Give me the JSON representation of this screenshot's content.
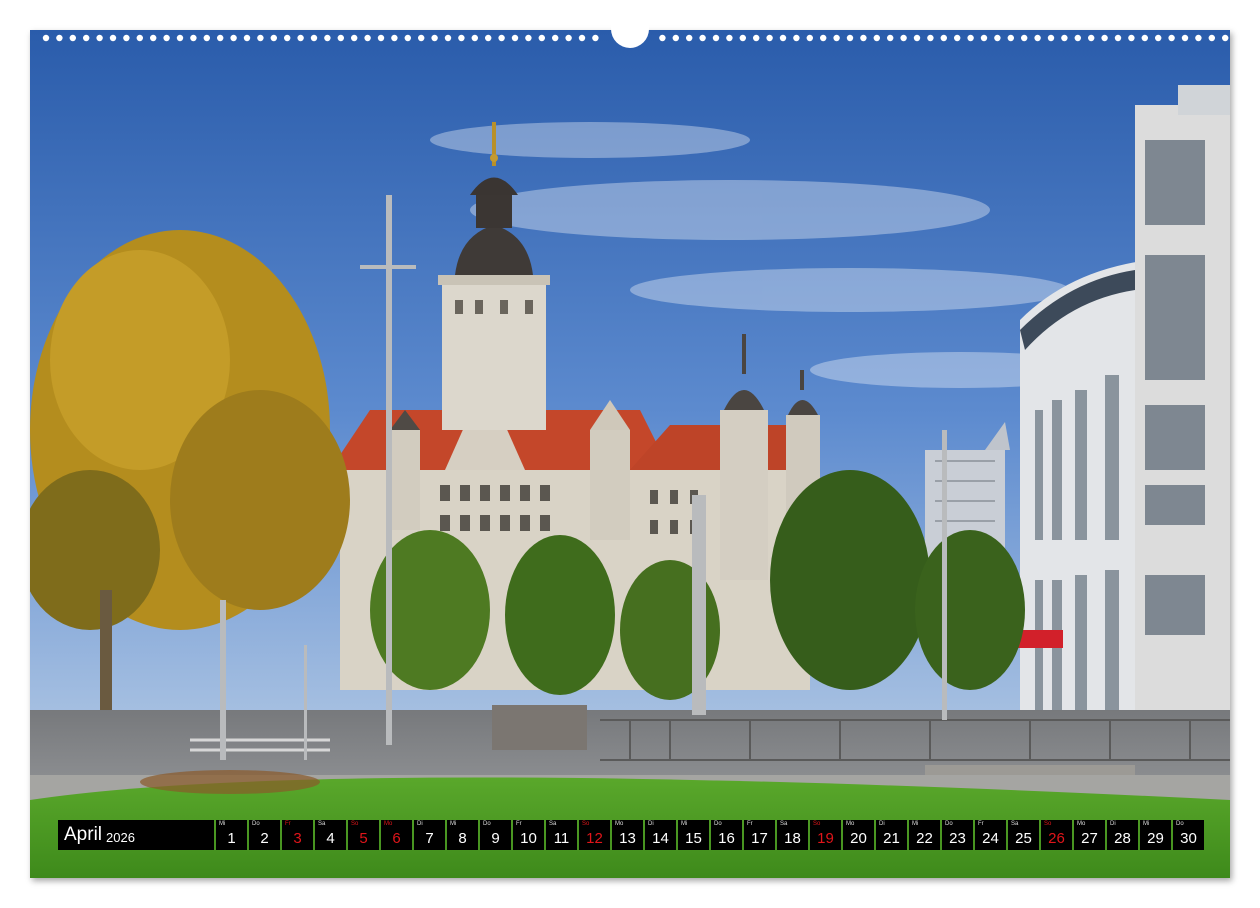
{
  "calendar": {
    "month": "April",
    "year": "2026",
    "days": [
      {
        "wd": "Mi",
        "d": "1",
        "red": false
      },
      {
        "wd": "Do",
        "d": "2",
        "red": false
      },
      {
        "wd": "Fr",
        "d": "3",
        "red": true
      },
      {
        "wd": "Sa",
        "d": "4",
        "red": false
      },
      {
        "wd": "So",
        "d": "5",
        "red": true
      },
      {
        "wd": "Mo",
        "d": "6",
        "red": true
      },
      {
        "wd": "Di",
        "d": "7",
        "red": false
      },
      {
        "wd": "Mi",
        "d": "8",
        "red": false
      },
      {
        "wd": "Do",
        "d": "9",
        "red": false
      },
      {
        "wd": "Fr",
        "d": "10",
        "red": false
      },
      {
        "wd": "Sa",
        "d": "11",
        "red": false
      },
      {
        "wd": "So",
        "d": "12",
        "red": true
      },
      {
        "wd": "Mo",
        "d": "13",
        "red": false
      },
      {
        "wd": "Di",
        "d": "14",
        "red": false
      },
      {
        "wd": "Mi",
        "d": "15",
        "red": false
      },
      {
        "wd": "Do",
        "d": "16",
        "red": false
      },
      {
        "wd": "Fr",
        "d": "17",
        "red": false
      },
      {
        "wd": "Sa",
        "d": "18",
        "red": false
      },
      {
        "wd": "So",
        "d": "19",
        "red": true
      },
      {
        "wd": "Mo",
        "d": "20",
        "red": false
      },
      {
        "wd": "Di",
        "d": "21",
        "red": false
      },
      {
        "wd": "Mi",
        "d": "22",
        "red": false
      },
      {
        "wd": "Do",
        "d": "23",
        "red": false
      },
      {
        "wd": "Fr",
        "d": "24",
        "red": false
      },
      {
        "wd": "Sa",
        "d": "25",
        "red": false
      },
      {
        "wd": "So",
        "d": "26",
        "red": true
      },
      {
        "wd": "Mo",
        "d": "27",
        "red": false
      },
      {
        "wd": "Di",
        "d": "28",
        "red": false
      },
      {
        "wd": "Mi",
        "d": "29",
        "red": false
      },
      {
        "wd": "Do",
        "d": "30",
        "red": false
      }
    ]
  },
  "colors": {
    "sky_top": "#2f62b0",
    "sky_bottom": "#8fb2e0",
    "grass": "#4e9a23",
    "roof": "#c8482a",
    "stone": "#d8d3c8",
    "tree_autumn": "#b8901e",
    "tree_green": "#3f6a1e",
    "holiday_red": "#e0151a"
  }
}
